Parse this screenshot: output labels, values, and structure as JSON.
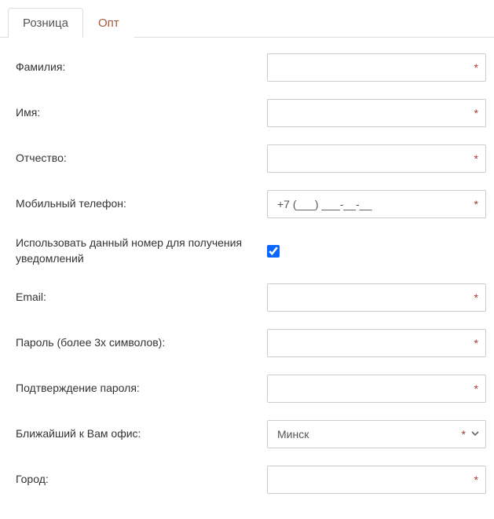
{
  "tabs": {
    "retail": "Розница",
    "wholesale": "Опт"
  },
  "fields": {
    "lastname": {
      "label": "Фамилия:",
      "value": "",
      "required": true
    },
    "firstname": {
      "label": "Имя:",
      "value": "",
      "required": true
    },
    "middlename": {
      "label": "Отчество:",
      "value": "",
      "required": true
    },
    "phone": {
      "label": "Мобильный телефон:",
      "value": "+7 (___) ___-__-__",
      "required": true
    },
    "notify": {
      "label": "Использовать данный номер для получения уведомлений",
      "checked": true
    },
    "email": {
      "label": "Email:",
      "value": "",
      "required": true
    },
    "password": {
      "label": "Пароль (более 3х символов):",
      "value": "",
      "required": true
    },
    "password_confirm": {
      "label": "Подтверждение пароля:",
      "value": "",
      "required": true
    },
    "office": {
      "label": "Ближайший к Вам офис:",
      "value": "Минск",
      "required": true
    },
    "city": {
      "label": "Город:",
      "value": "",
      "required": true
    }
  },
  "required_mark": "*"
}
